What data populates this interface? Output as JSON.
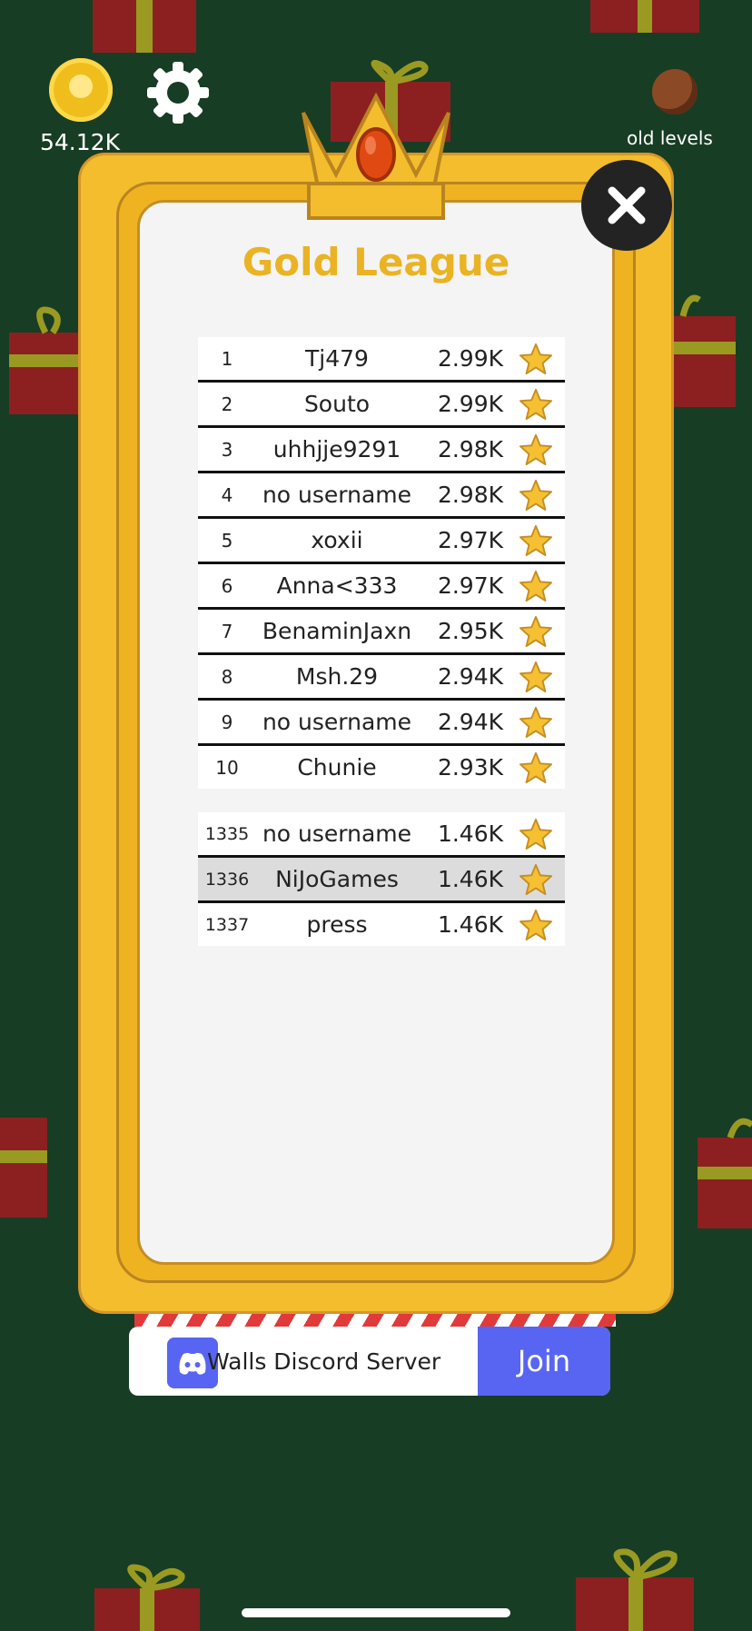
{
  "hud": {
    "coins": "54.12K",
    "old_levels_label": "old levels"
  },
  "league": {
    "title": "Gold League"
  },
  "leaderboard_top": [
    {
      "rank": "1",
      "name": "Tj479",
      "score": "2.99K"
    },
    {
      "rank": "2",
      "name": "Souto",
      "score": "2.99K"
    },
    {
      "rank": "3",
      "name": "uhhjje9291",
      "score": "2.98K"
    },
    {
      "rank": "4",
      "name": "no username",
      "score": "2.98K"
    },
    {
      "rank": "5",
      "name": "xoxii",
      "score": "2.97K"
    },
    {
      "rank": "6",
      "name": "Anna<333",
      "score": "2.97K"
    },
    {
      "rank": "7",
      "name": "BenaminJaxn",
      "score": "2.95K"
    },
    {
      "rank": "8",
      "name": "Msh.29",
      "score": "2.94K"
    },
    {
      "rank": "9",
      "name": "no username",
      "score": "2.94K"
    },
    {
      "rank": "10",
      "name": "Chunie",
      "score": "2.93K"
    }
  ],
  "leaderboard_near": [
    {
      "rank": "1335",
      "name": "no username",
      "score": "1.46K"
    },
    {
      "rank": "1336",
      "name": "NiJoGames",
      "score": "1.46K",
      "highlighted": true
    },
    {
      "rank": "1337",
      "name": "press",
      "score": "1.46K"
    }
  ],
  "discord": {
    "label": "Walls Discord Server",
    "join_label": "Join"
  },
  "colors": {
    "background": "#173d24",
    "gold": "#f3bd2d",
    "title": "#eab323",
    "discord": "#5865f2"
  }
}
